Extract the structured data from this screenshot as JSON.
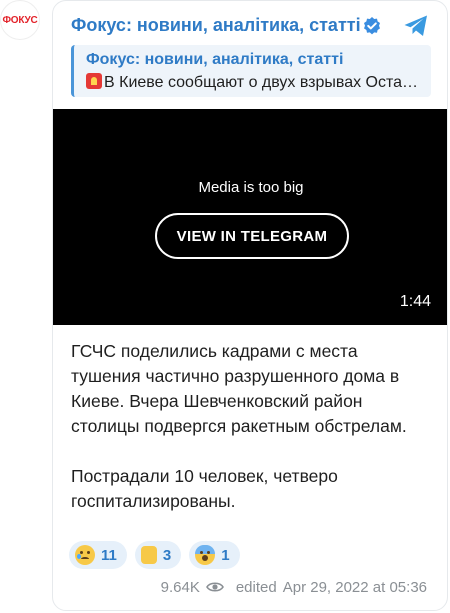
{
  "avatar": {
    "logo_text": "ФОКУС"
  },
  "header": {
    "channel_name": "Фокус: новини, аналітика, статті",
    "verified_icon": "verified-check-icon",
    "telegram_icon": "telegram-logo-icon"
  },
  "reply": {
    "title": "Фокус: новини, аналітика, статті",
    "text": "В Киеве сообщают о двух взрывах Оста…",
    "icon": "siren-icon"
  },
  "media": {
    "message": "Media is too big",
    "button_label": "VIEW IN TELEGRAM",
    "duration": "1:44"
  },
  "body": {
    "paragraphs": [
      "ГСЧС поделились кадрами с места тушения частично разрушенного дома в Киеве. Вчера Шевченковский район столицы подвергся ракетным обстрелам.",
      "Пострадали 10 человек, четверо госпитализированы."
    ]
  },
  "reactions": [
    {
      "emoji": "crying-face",
      "count": "11"
    },
    {
      "emoji": "thumbs-up",
      "count": "3"
    },
    {
      "emoji": "screaming-face",
      "count": "1"
    }
  ],
  "footer": {
    "views": "9.64K",
    "edited": "edited",
    "date": "Apr 29, 2022 at 05:36"
  },
  "colors": {
    "accent": "#2f7bc6",
    "reply_bg": "#eef4fa",
    "reaction_bg": "#e6f0fa",
    "muted": "#8a8f94",
    "logo_red": "#e3222a"
  }
}
